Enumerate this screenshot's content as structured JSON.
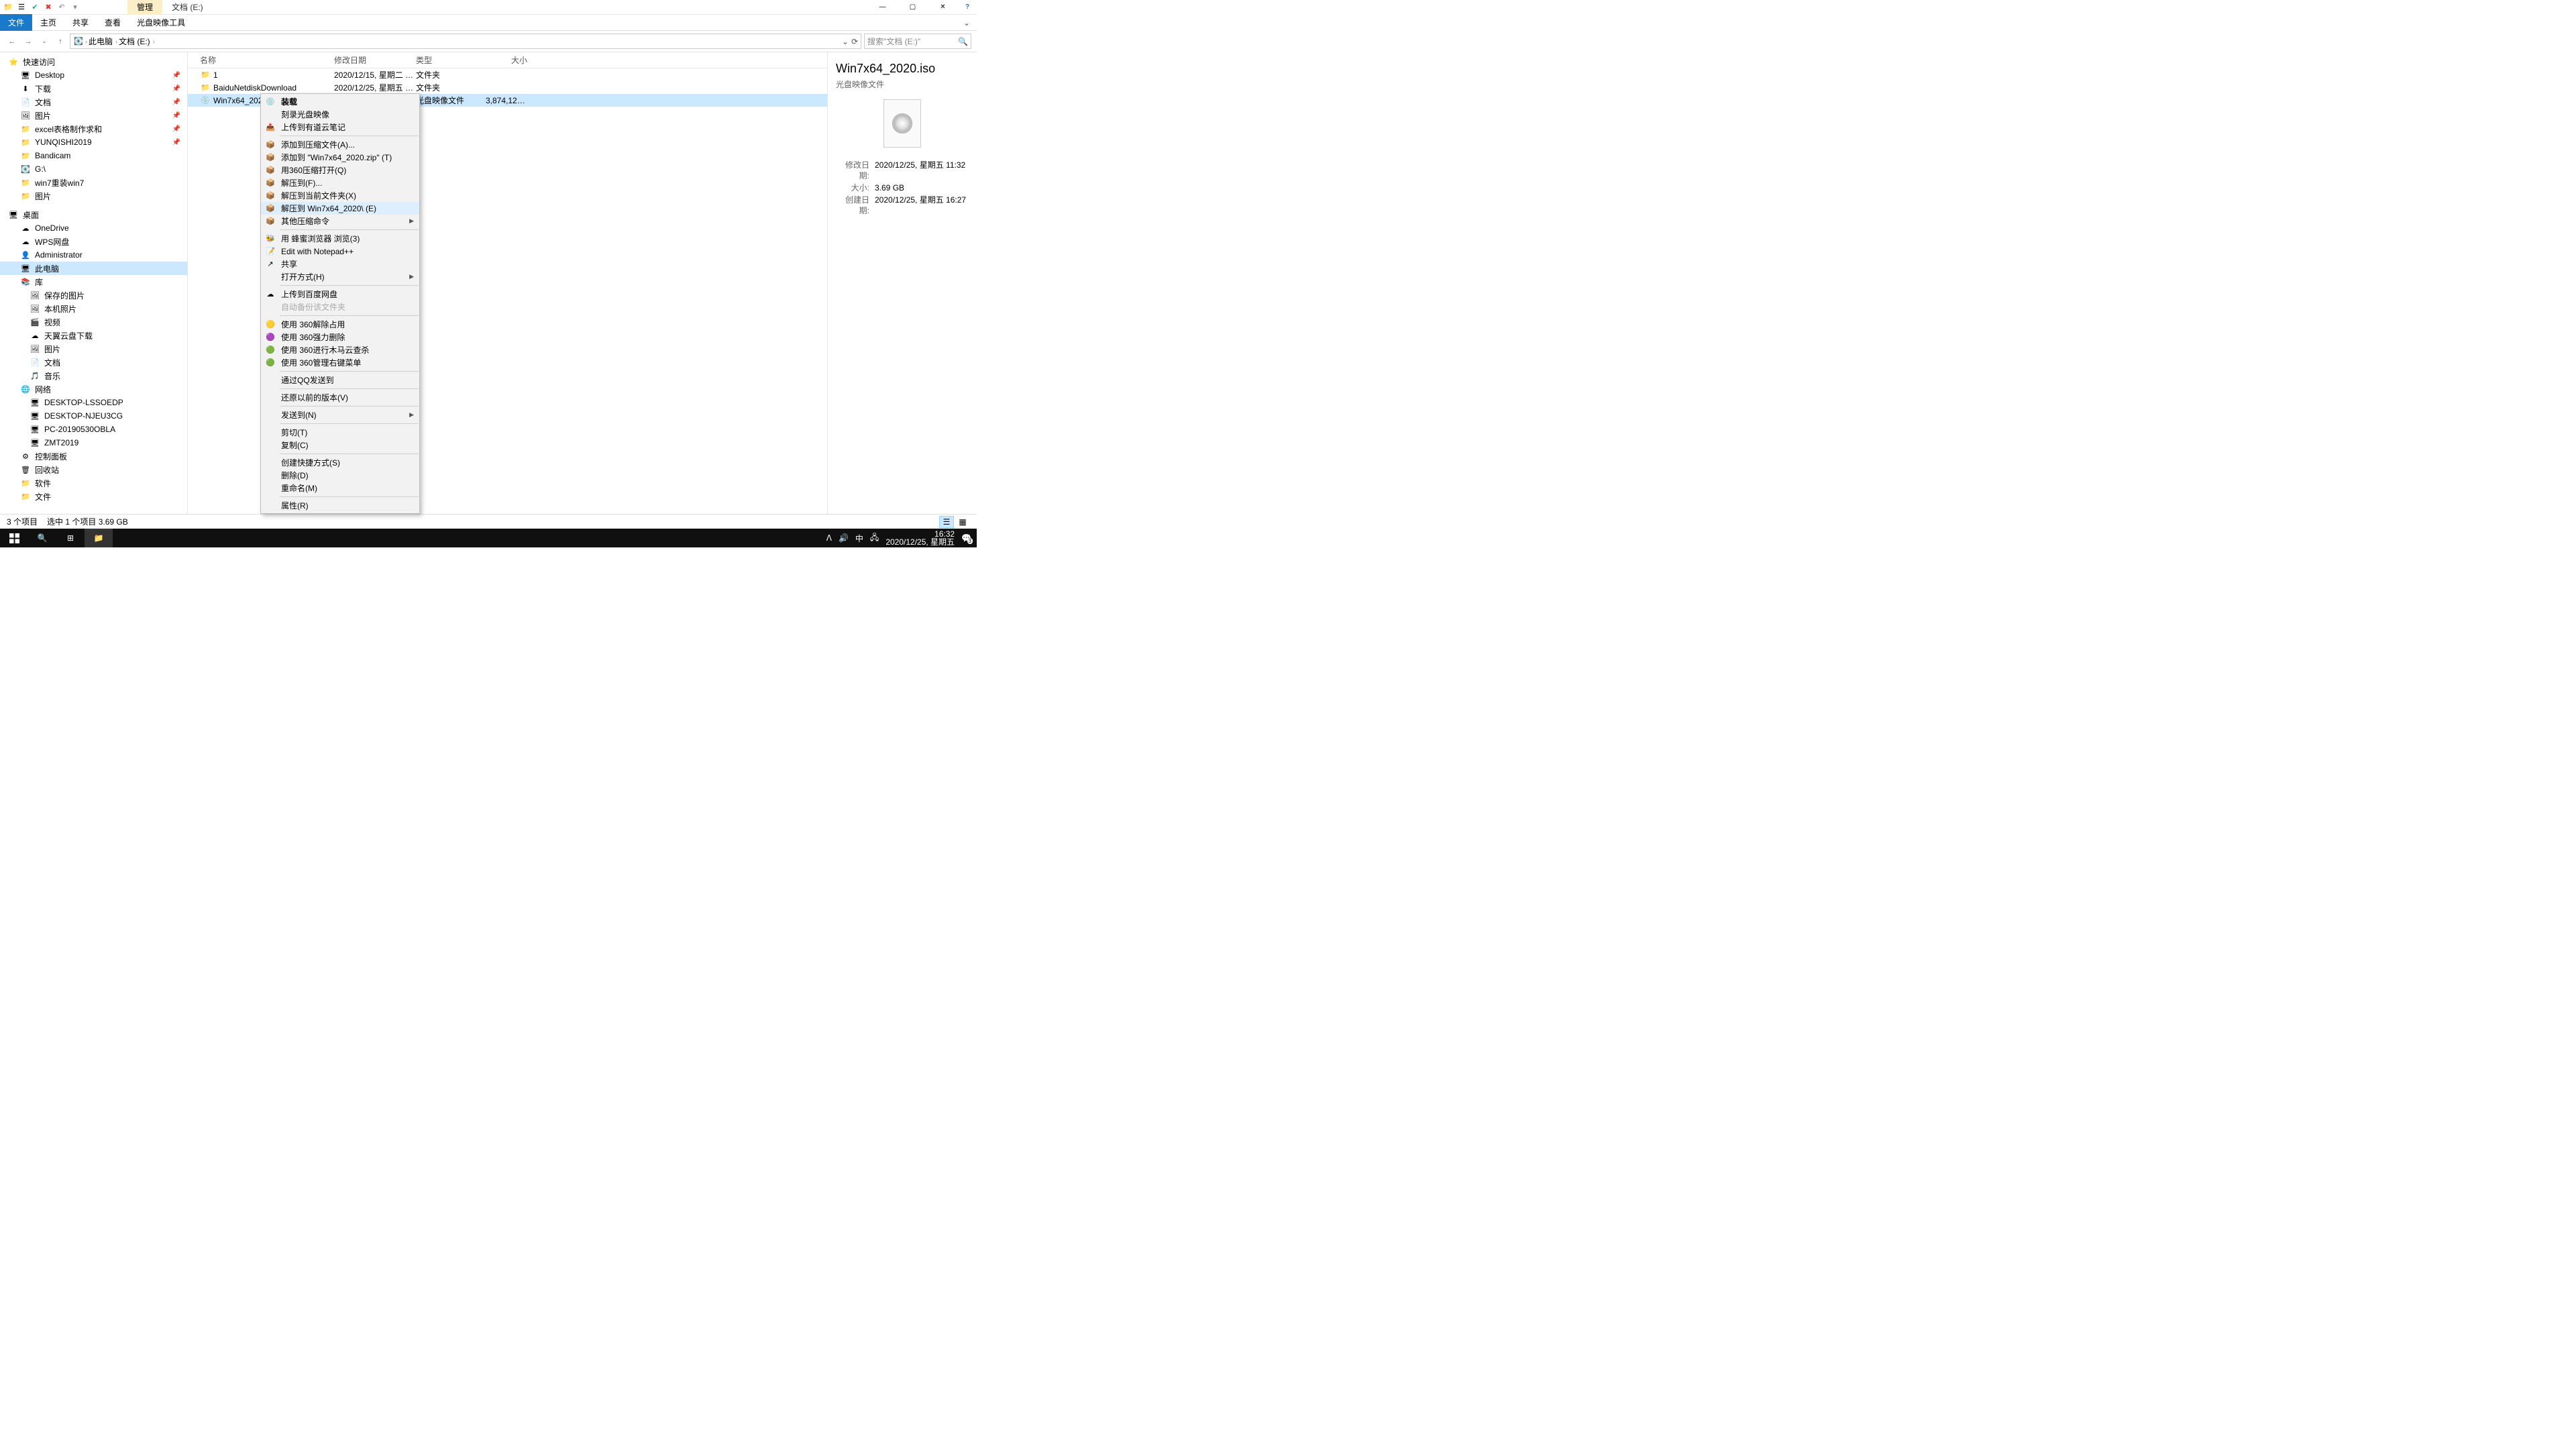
{
  "title_tabs": {
    "manage": "管理",
    "location": "文档 (E:)"
  },
  "window_controls": {
    "min": "—",
    "max": "▢",
    "close": "✕",
    "help": "?"
  },
  "menubar": {
    "file": "文件",
    "home": "主页",
    "share": "共享",
    "view": "查看",
    "disctools": "光盘映像工具"
  },
  "nav": {
    "back": "←",
    "fwd": "→",
    "up": "↑"
  },
  "breadcrumb": {
    "pc": "此电脑",
    "drive": "文档 (E:)"
  },
  "address_controls": {
    "dropdown": "⌄",
    "refresh": "⟳"
  },
  "search": {
    "placeholder": "搜索\"文档 (E:)\""
  },
  "tree": {
    "quick": "快速访问",
    "items1": [
      {
        "ic": "🖥",
        "t": "Desktop",
        "pin": true
      },
      {
        "ic": "⬇",
        "t": "下载",
        "pin": true
      },
      {
        "ic": "📄",
        "t": "文档",
        "pin": true
      },
      {
        "ic": "🖼",
        "t": "图片",
        "pin": true
      },
      {
        "ic": "📁",
        "t": "excel表格制作求和",
        "pin": true
      },
      {
        "ic": "📁",
        "t": "YUNQISHI2019",
        "pin": true
      },
      {
        "ic": "📁",
        "t": "Bandicam"
      },
      {
        "ic": "💽",
        "t": "G:\\"
      },
      {
        "ic": "📁",
        "t": "win7重装win7"
      },
      {
        "ic": "📁",
        "t": "图片"
      }
    ],
    "desktop": "桌面",
    "items2": [
      {
        "ic": "☁",
        "t": "OneDrive"
      },
      {
        "ic": "☁",
        "t": "WPS网盘"
      },
      {
        "ic": "👤",
        "t": "Administrator"
      },
      {
        "ic": "🖥",
        "t": "此电脑",
        "sel": true
      },
      {
        "ic": "📚",
        "t": "库"
      }
    ],
    "items3": [
      {
        "ic": "🖼",
        "t": "保存的图片"
      },
      {
        "ic": "🖼",
        "t": "本机照片"
      },
      {
        "ic": "🎬",
        "t": "视频"
      },
      {
        "ic": "☁",
        "t": "天翼云盘下载"
      },
      {
        "ic": "🖼",
        "t": "图片"
      },
      {
        "ic": "📄",
        "t": "文档"
      },
      {
        "ic": "🎵",
        "t": "音乐"
      }
    ],
    "network": "网络",
    "items4": [
      {
        "ic": "🖥",
        "t": "DESKTOP-LSSOEDP"
      },
      {
        "ic": "🖥",
        "t": "DESKTOP-NJEU3CG"
      },
      {
        "ic": "🖥",
        "t": "PC-20190530OBLA"
      },
      {
        "ic": "🖥",
        "t": "ZMT2019"
      }
    ],
    "items5": [
      {
        "ic": "⚙",
        "t": "控制面板"
      },
      {
        "ic": "🗑",
        "t": "回收站"
      },
      {
        "ic": "📁",
        "t": "软件"
      },
      {
        "ic": "📁",
        "t": "文件"
      }
    ]
  },
  "cols": {
    "name": "名称",
    "date": "修改日期",
    "type": "类型",
    "size": "大小"
  },
  "rows": [
    {
      "ic": "📁",
      "name": "1",
      "date": "2020/12/15, 星期二 1...",
      "type": "文件夹",
      "size": ""
    },
    {
      "ic": "📁",
      "name": "BaiduNetdiskDownload",
      "date": "2020/12/25, 星期五 1...",
      "type": "文件夹",
      "size": ""
    },
    {
      "ic": "💿",
      "name": "Win7x64_2020.iso",
      "date": "2020/12/25, 星期五 1...",
      "type": "光盘映像文件",
      "size": "3,874,126...",
      "sel": true
    }
  ],
  "preview": {
    "title": "Win7x64_2020.iso",
    "sub": "光盘映像文件",
    "meta": [
      {
        "k": "修改日期:",
        "v": "2020/12/25, 星期五 11:32"
      },
      {
        "k": "大小:",
        "v": "3.69 GB"
      },
      {
        "k": "创建日期:",
        "v": "2020/12/25, 星期五 16:27"
      }
    ]
  },
  "status": {
    "count": "3 个项目",
    "sel": "选中 1 个项目  3.69 GB"
  },
  "ctx": [
    {
      "ic": "💿",
      "t": "装载",
      "bold": true
    },
    {
      "t": "刻录光盘映像"
    },
    {
      "ic": "📤",
      "t": "上传到有道云笔记"
    },
    {
      "sep": true
    },
    {
      "ic": "📦",
      "t": "添加到压缩文件(A)..."
    },
    {
      "ic": "📦",
      "t": "添加到 \"Win7x64_2020.zip\" (T)"
    },
    {
      "ic": "📦",
      "t": "用360压缩打开(Q)"
    },
    {
      "ic": "📦",
      "t": "解压到(F)..."
    },
    {
      "ic": "📦",
      "t": "解压到当前文件夹(X)"
    },
    {
      "ic": "📦",
      "t": "解压到 Win7x64_2020\\ (E)",
      "hov": true
    },
    {
      "ic": "📦",
      "t": "其他压缩命令",
      "sub": true
    },
    {
      "sep": true
    },
    {
      "ic": "🐝",
      "t": "用 蜂蜜浏览器 浏览(3)"
    },
    {
      "ic": "📝",
      "t": "Edit with Notepad++"
    },
    {
      "ic": "↗",
      "t": "共享"
    },
    {
      "t": "打开方式(H)",
      "sub": true
    },
    {
      "sep": true
    },
    {
      "ic": "☁",
      "t": "上传到百度网盘"
    },
    {
      "t": "自动备份该文件夹",
      "dis": true
    },
    {
      "sep": true
    },
    {
      "ic": "🟡",
      "t": "使用 360解除占用"
    },
    {
      "ic": "🟣",
      "t": "使用 360强力删除"
    },
    {
      "ic": "🟢",
      "t": "使用 360进行木马云查杀"
    },
    {
      "ic": "🟢",
      "t": "使用 360管理右键菜单"
    },
    {
      "sep": true
    },
    {
      "t": "通过QQ发送到"
    },
    {
      "sep": true
    },
    {
      "t": "还原以前的版本(V)"
    },
    {
      "sep": true
    },
    {
      "t": "发送到(N)",
      "sub": true
    },
    {
      "sep": true
    },
    {
      "t": "剪切(T)"
    },
    {
      "t": "复制(C)"
    },
    {
      "sep": true
    },
    {
      "t": "创建快捷方式(S)"
    },
    {
      "t": "删除(D)"
    },
    {
      "t": "重命名(M)"
    },
    {
      "sep": true
    },
    {
      "t": "属性(R)"
    }
  ],
  "taskbar": {
    "clock_time": "16:32",
    "clock_date": "2020/12/25, 星期五",
    "ime": "中",
    "notif": "3"
  }
}
